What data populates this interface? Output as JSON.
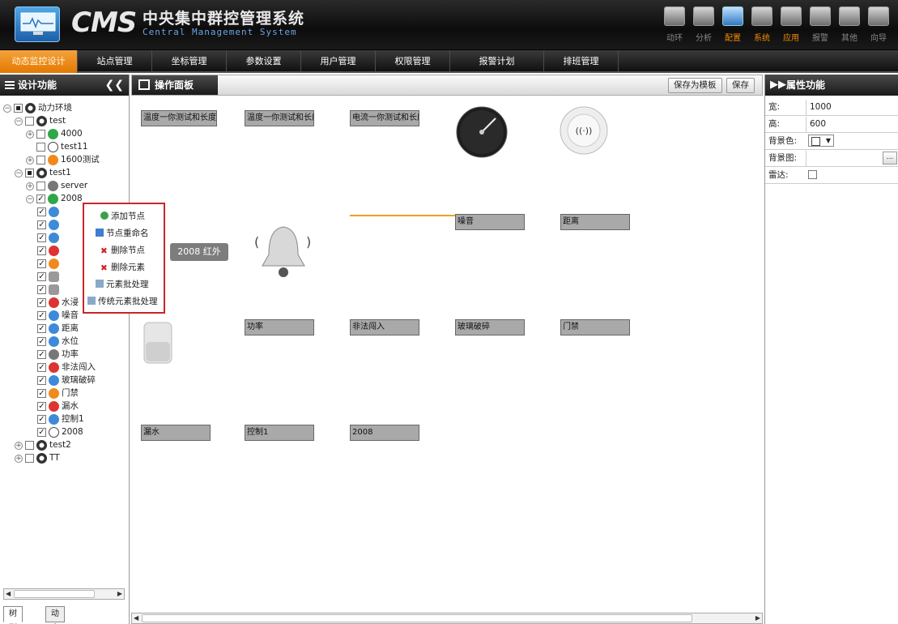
{
  "app": {
    "brand": "CMS",
    "title_zh": "中央集中群控管理系统",
    "title_en": "Central Management System"
  },
  "toolbar": [
    {
      "label": "动环",
      "icon": "env-monitor-icon"
    },
    {
      "label": "分析",
      "icon": "analysis-icon"
    },
    {
      "label": "配置",
      "icon": "config-icon",
      "active": true
    },
    {
      "label": "系统",
      "icon": "system-icon"
    },
    {
      "label": "应用",
      "icon": "app-icon"
    },
    {
      "label": "报警",
      "icon": "alarm-icon"
    },
    {
      "label": "其他",
      "icon": "other-icon"
    },
    {
      "label": "向导",
      "icon": "wizard-icon"
    }
  ],
  "nav": [
    {
      "label": "动态监控设计",
      "active": true
    },
    {
      "label": "站点管理"
    },
    {
      "label": "坐标管理"
    },
    {
      "label": "参数设置"
    },
    {
      "label": "用户管理"
    },
    {
      "label": "权限管理"
    },
    {
      "label": "报警计划"
    },
    {
      "label": "排班管理"
    }
  ],
  "left_panel": {
    "title": "设计功能",
    "tree": [
      {
        "label": "动力环境",
        "checked": "partial"
      },
      {
        "label": "test",
        "checked": false
      },
      {
        "label": "4000",
        "checked": false
      },
      {
        "label": "test11",
        "checked": false
      },
      {
        "label": "1600测试",
        "checked": false
      },
      {
        "label": "test1",
        "checked": "partial"
      },
      {
        "label": "server",
        "checked": false
      },
      {
        "label": "2008",
        "checked": true
      },
      {
        "label": "水浸",
        "checked": true
      },
      {
        "label": "噪音",
        "checked": true
      },
      {
        "label": "距离",
        "checked": true
      },
      {
        "label": "水位",
        "checked": true
      },
      {
        "label": "功率",
        "checked": true
      },
      {
        "label": "非法闯入",
        "checked": true
      },
      {
        "label": "玻璃破碎",
        "checked": true
      },
      {
        "label": "门禁",
        "checked": true
      },
      {
        "label": "漏水",
        "checked": true
      },
      {
        "label": "控制1",
        "checked": true
      },
      {
        "label": "2008",
        "checked": true
      },
      {
        "label": "test2",
        "checked": false
      },
      {
        "label": "TT",
        "checked": false
      }
    ],
    "tabs": [
      "树列表",
      "动态设计"
    ]
  },
  "context_menu": [
    "添加节点",
    "节点重命名",
    "删除节点",
    "删除元素",
    "元素批处理",
    "传统元素批处理"
  ],
  "center": {
    "title": "操作面板",
    "save_template": "保存为模板",
    "save": "保存",
    "labels": {
      "temp1": "温度一你测试和长度和",
      "temp2": "温度一你测试和长度",
      "current": "电流一你测试和长度",
      "noise": "噪音",
      "distance": "距离",
      "power": "功率",
      "intrusion": "非法闯入",
      "glass": "玻璃破碎",
      "door": "门禁",
      "leak": "漏水",
      "control": "控制1",
      "d2008": "2008",
      "tag": "2008 红外"
    }
  },
  "right_panel": {
    "title": "属性功能",
    "props": {
      "width_label": "宽:",
      "width_value": "1000",
      "height_label": "高:",
      "height_value": "600",
      "bgcolor_label": "背景色:",
      "bgimage_label": "背景图:",
      "radar_label": "雷达:"
    }
  }
}
